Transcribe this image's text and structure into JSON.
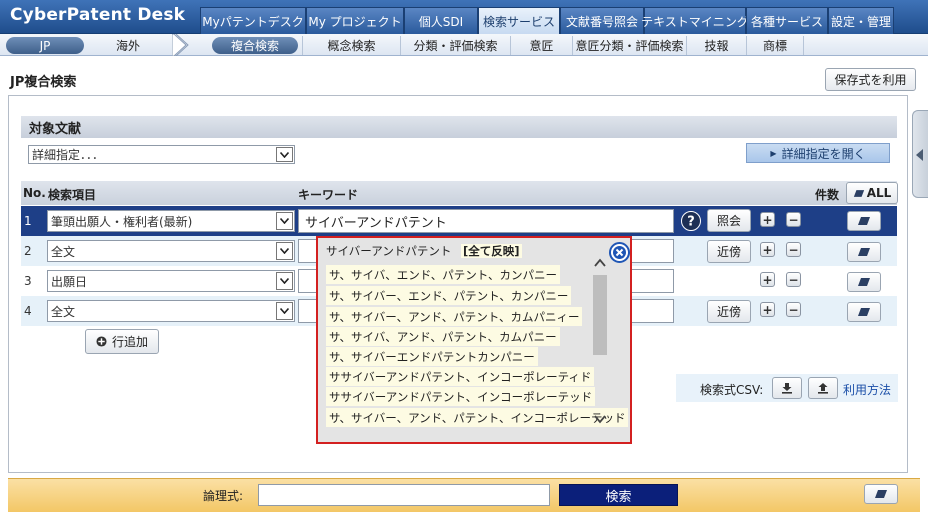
{
  "app": {
    "logo": "CyberPatent Desk"
  },
  "top_tabs": [
    {
      "label": "Myパテントデスク",
      "active": false
    },
    {
      "label": "My プロジェクト",
      "active": false
    },
    {
      "label": "個人SDI",
      "active": false
    },
    {
      "label": "検索サービス",
      "active": true
    },
    {
      "label": "文献番号照会",
      "active": false
    },
    {
      "label": "テキストマイニング",
      "active": false
    },
    {
      "label": "各種サービス",
      "active": false
    },
    {
      "label": "設定・管理",
      "active": false
    }
  ],
  "sub_nav": {
    "region_jp": "JP",
    "region_foreign": "海外",
    "items": [
      "複合検索",
      "概念検索",
      "分類・評価検索",
      "意匠",
      "意匠分類・評価検索",
      "技報",
      "商標"
    ]
  },
  "page": {
    "title": "JP複合検索",
    "use_saved_label": "保存式を利用"
  },
  "target": {
    "header": "対象文献",
    "select_value": "詳細指定．．．",
    "open_detail_label": "詳細指定を開く"
  },
  "table": {
    "col_no": "No.",
    "col_item": "検索項目",
    "col_keyword": "キーワード",
    "col_count": "件数",
    "clear_all_label": "ALL",
    "rows": [
      {
        "no": "1",
        "item": "筆頭出願人・権利者(最新)",
        "keyword": "サイバーアンドパテント",
        "action": "照会"
      },
      {
        "no": "2",
        "item": "全文",
        "keyword": "",
        "action": "近傍"
      },
      {
        "no": "3",
        "item": "出願日",
        "keyword": "",
        "action": ""
      },
      {
        "no": "4",
        "item": "全文",
        "keyword": "",
        "action": "近傍"
      }
    ],
    "add_row_label": "行追加",
    "plus": "+",
    "minus": "−",
    "help": "?"
  },
  "suggestions": {
    "header_text": "サイバーアンドパテント",
    "reflect_all": "[全て反映]",
    "items": [
      "サ、サイバ、エンド、パテント、カンパニー",
      "サ、サイバー、エンド、パテント、カンパニー",
      "サ、サイバー、アンド、パテント、カムパニィー",
      "サ、サイバ、アンド、パテント、カムパニー",
      "サ、サイバーエンドパテントカンパニー",
      "ササイバーアンドパテント、インコーポレーティド",
      "ササイバーアンドパテント、インコーポレーテッド",
      "サ、サイバー、アンド、パテント、インコーポレーテッド"
    ]
  },
  "csv": {
    "label": "検索式CSV:",
    "usage_link": "利用方法"
  },
  "bottom": {
    "logic_label": "論理式:",
    "logic_value": "",
    "search_label": "検索"
  }
}
